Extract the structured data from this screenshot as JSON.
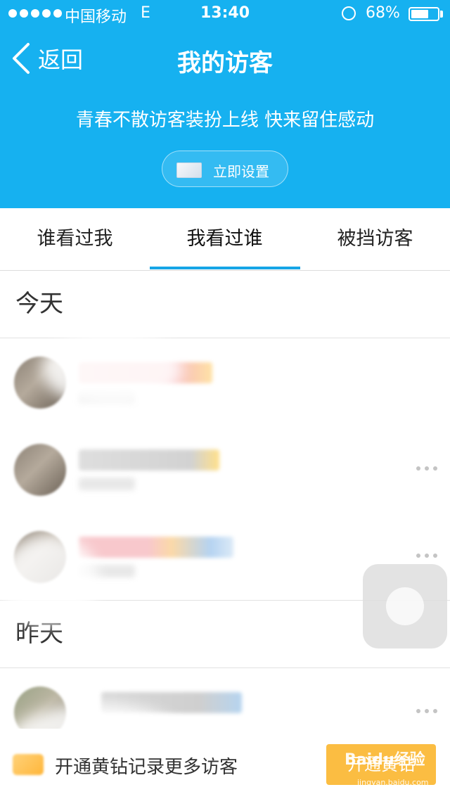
{
  "status_bar": {
    "carrier": "中国移动",
    "network": "E",
    "time": "13:40",
    "battery_percent": "68%",
    "battery_level": 0.68,
    "icons": [
      "signal-dots-icon",
      "rotation-lock-icon",
      "battery-icon"
    ]
  },
  "nav": {
    "back_label": "返回",
    "title": "我的访客"
  },
  "promo": {
    "text": "青春不散访客装扮上线 快来留住感动",
    "button_label": "立即设置"
  },
  "tabs": [
    {
      "label": "谁看过我",
      "active": false
    },
    {
      "label": "我看过谁",
      "active": true
    },
    {
      "label": "被挡访客",
      "active": false
    }
  ],
  "sections": [
    {
      "title": "今天"
    },
    {
      "title": "昨天"
    }
  ],
  "bottom_bar": {
    "text": "开通黄钻记录更多访客",
    "button_label": "开通黄钻"
  },
  "watermark": {
    "text": "Baidu经验",
    "sub": "jingyan.baidu.com"
  },
  "colors": {
    "header_bg": "#16b1f0",
    "tab_indicator": "#16a5e6",
    "vip_button": "#fbbd42"
  }
}
